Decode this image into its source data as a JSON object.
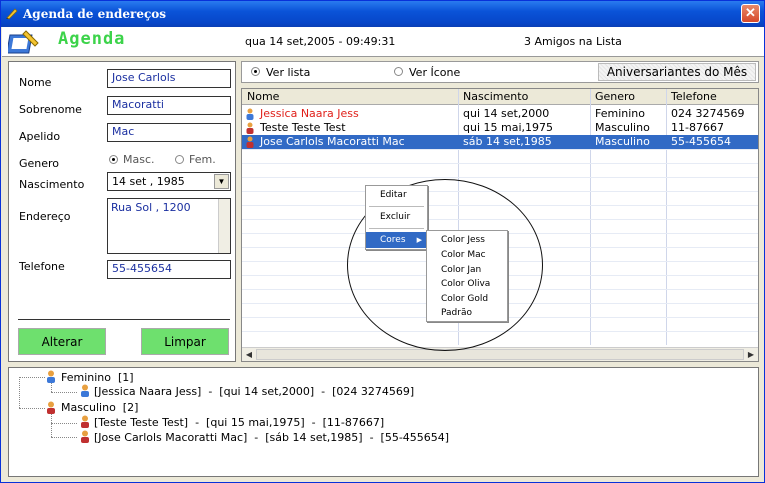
{
  "window": {
    "title": "Agenda de endereços"
  },
  "header": {
    "app_title": "Agenda",
    "datetime": "qua 14 set,2005 - 09:49:31",
    "friends_count": "3 Amigos na Lista"
  },
  "form": {
    "labels": {
      "nome": "Nome",
      "sobrenome": "Sobrenome",
      "apelido": "Apelido",
      "genero": "Genero",
      "nascimento": "Nascimento",
      "endereco": "Endereço",
      "telefone": "Telefone"
    },
    "values": {
      "nome": "Jose Carlols",
      "sobrenome": "Macoratti",
      "apelido": "Mac",
      "nascimento": "14 set , 1985",
      "endereco": "Rua Sol , 1200",
      "telefone": "55-455654"
    },
    "genero_options": {
      "masc": "Masc.",
      "fem": "Fem.",
      "selected": "masc"
    },
    "buttons": {
      "alterar": "Alterar",
      "limpar": "Limpar"
    }
  },
  "view": {
    "ver_lista": "Ver lista",
    "ver_icone": "Ver Ícone",
    "selected": "lista",
    "aniversariantes": "Aniversariantes do Mês"
  },
  "list": {
    "columns": [
      "Nome",
      "Nascimento",
      "Genero",
      "Telefone"
    ],
    "rows": [
      {
        "nome": "Jessica Naara Jess",
        "nascimento": "qui 14 set,2000",
        "genero": "Feminino",
        "telefone": "024 3274569",
        "color": "#E0201A",
        "selected": false
      },
      {
        "nome": "Teste Teste Test",
        "nascimento": "qui 15 mai,1975",
        "genero": "Masculino",
        "telefone": "11-87667",
        "color": "#000000",
        "selected": false
      },
      {
        "nome": "Jose Carlols Macoratti Mac",
        "nascimento": "sáb 14 set,1985",
        "genero": "Masculino",
        "telefone": "55-455654",
        "color": "#FFFFFF",
        "selected": true
      }
    ]
  },
  "context_menu": {
    "items": [
      "Editar",
      "Excluir",
      "Cores"
    ],
    "submenu": [
      "Color Jess",
      "Color Mac",
      "Color Jan",
      "Color Oliva",
      "Color Gold",
      "Padrão"
    ]
  },
  "tree": {
    "feminino": "Feminino  [1]",
    "feminino_child": "[Jessica Naara Jess]  -  [qui 14 set,2000]  -  [024 3274569]",
    "masculino": "Masculino  [2]",
    "masculino_child1": "[Teste Teste Test]  -  [qui 15 mai,1975]  -  [11-87667]",
    "masculino_child2": "[Jose Carlols Macoratti Mac]  -  [sáb 14 set,1985]  -  [55-455654]"
  },
  "colors": {
    "accent_green": "#3CD34A",
    "button_green": "#6EE06E",
    "selection_blue": "#316AC5"
  }
}
